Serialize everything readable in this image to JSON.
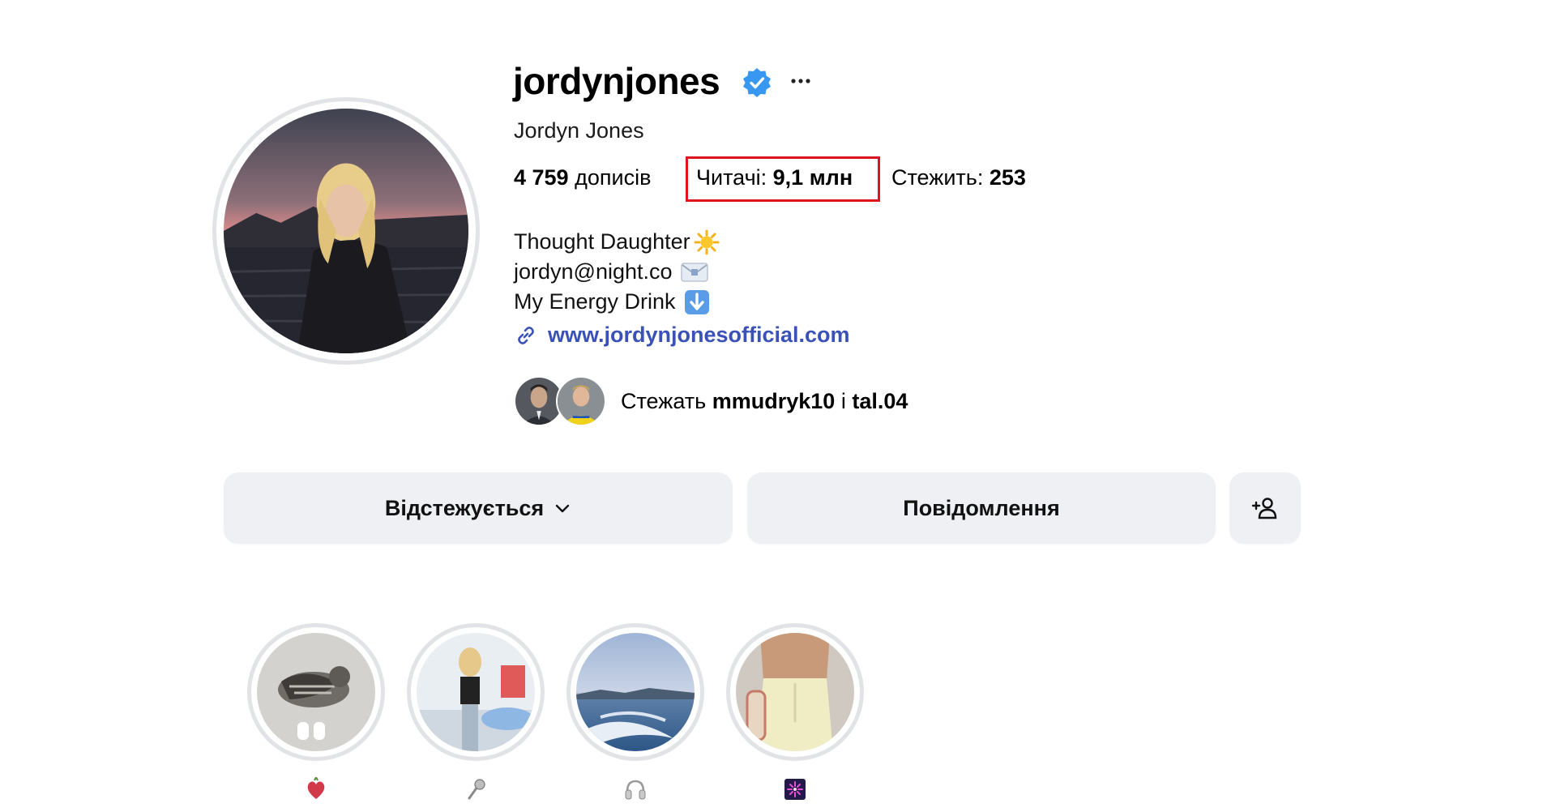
{
  "profile": {
    "username": "jordynjones",
    "full_name": "Jordyn Jones",
    "verified_icon": "verified-badge-icon",
    "more_icon": "more-horizontal-icon",
    "verified_color": "#3897f0"
  },
  "stats": {
    "posts_count": "4 759",
    "posts_label": "дописів",
    "followers_label": "Читачі:",
    "followers_count": "9,1 млн",
    "following_label": "Стежить:",
    "following_count": "253",
    "highlight_color": "#e0141c"
  },
  "bio": {
    "line1": "Thought Daughter",
    "line2": "jordyn@night.co",
    "line3": "My Energy Drink",
    "link": "www.jordynjonesofficial.com",
    "link_color": "#3a52b8"
  },
  "followed_by": {
    "prefix": "Стежать",
    "user1": "mmudryk10",
    "connector": "і",
    "user2": "tal.04"
  },
  "actions": {
    "following_label": "Відстежується",
    "message_label": "Повідомлення",
    "add_user_icon": "add-user-icon"
  },
  "highlights": [
    {
      "icon": "heart-icon"
    },
    {
      "icon": "microphone-icon"
    },
    {
      "icon": "headphones-icon"
    },
    {
      "icon": "fireworks-icon"
    }
  ]
}
